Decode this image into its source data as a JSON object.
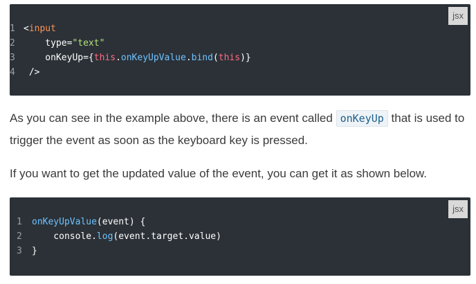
{
  "code_block_1": {
    "language": "jsx",
    "lines": [
      {
        "num": "1",
        "segments": [
          {
            "cls": "plain",
            "text": "<"
          },
          {
            "cls": "tag",
            "text": "input"
          }
        ]
      },
      {
        "num": "2",
        "segments": [
          {
            "cls": "plain",
            "text": "    type="
          },
          {
            "cls": "str",
            "text": "\"text\""
          }
        ]
      },
      {
        "num": "3",
        "segments": [
          {
            "cls": "plain",
            "text": "    onKeyUp={"
          },
          {
            "cls": "kw",
            "text": "this"
          },
          {
            "cls": "plain",
            "text": "."
          },
          {
            "cls": "fn",
            "text": "onKeyUpValue"
          },
          {
            "cls": "plain",
            "text": "."
          },
          {
            "cls": "fn",
            "text": "bind"
          },
          {
            "cls": "plain",
            "text": "("
          },
          {
            "cls": "kw",
            "text": "this"
          },
          {
            "cls": "plain",
            "text": ")}"
          }
        ]
      },
      {
        "num": "4",
        "segments": [
          {
            "cls": "plain",
            "text": " />"
          }
        ]
      }
    ]
  },
  "paragraph_1": {
    "before": "As you can see in the example above, there is an event called ",
    "code": "onKeyUp",
    "after": " that is used to trigger the event as soon as the keyboard key is pressed."
  },
  "paragraph_2": {
    "text": "If you want to get the updated value of the event, you can get it as shown below."
  },
  "code_block_2": {
    "language": "jsx",
    "lines": [
      {
        "num": "1",
        "segments": [
          {
            "cls": "fn",
            "text": "onKeyUpValue"
          },
          {
            "cls": "plain",
            "text": "(event) {"
          }
        ]
      },
      {
        "num": "2",
        "segments": [
          {
            "cls": "plain",
            "text": "    console."
          },
          {
            "cls": "fn",
            "text": "log"
          },
          {
            "cls": "plain",
            "text": "(event.target.value)"
          }
        ]
      },
      {
        "num": "3",
        "segments": [
          {
            "cls": "plain",
            "text": "}"
          }
        ]
      }
    ]
  }
}
